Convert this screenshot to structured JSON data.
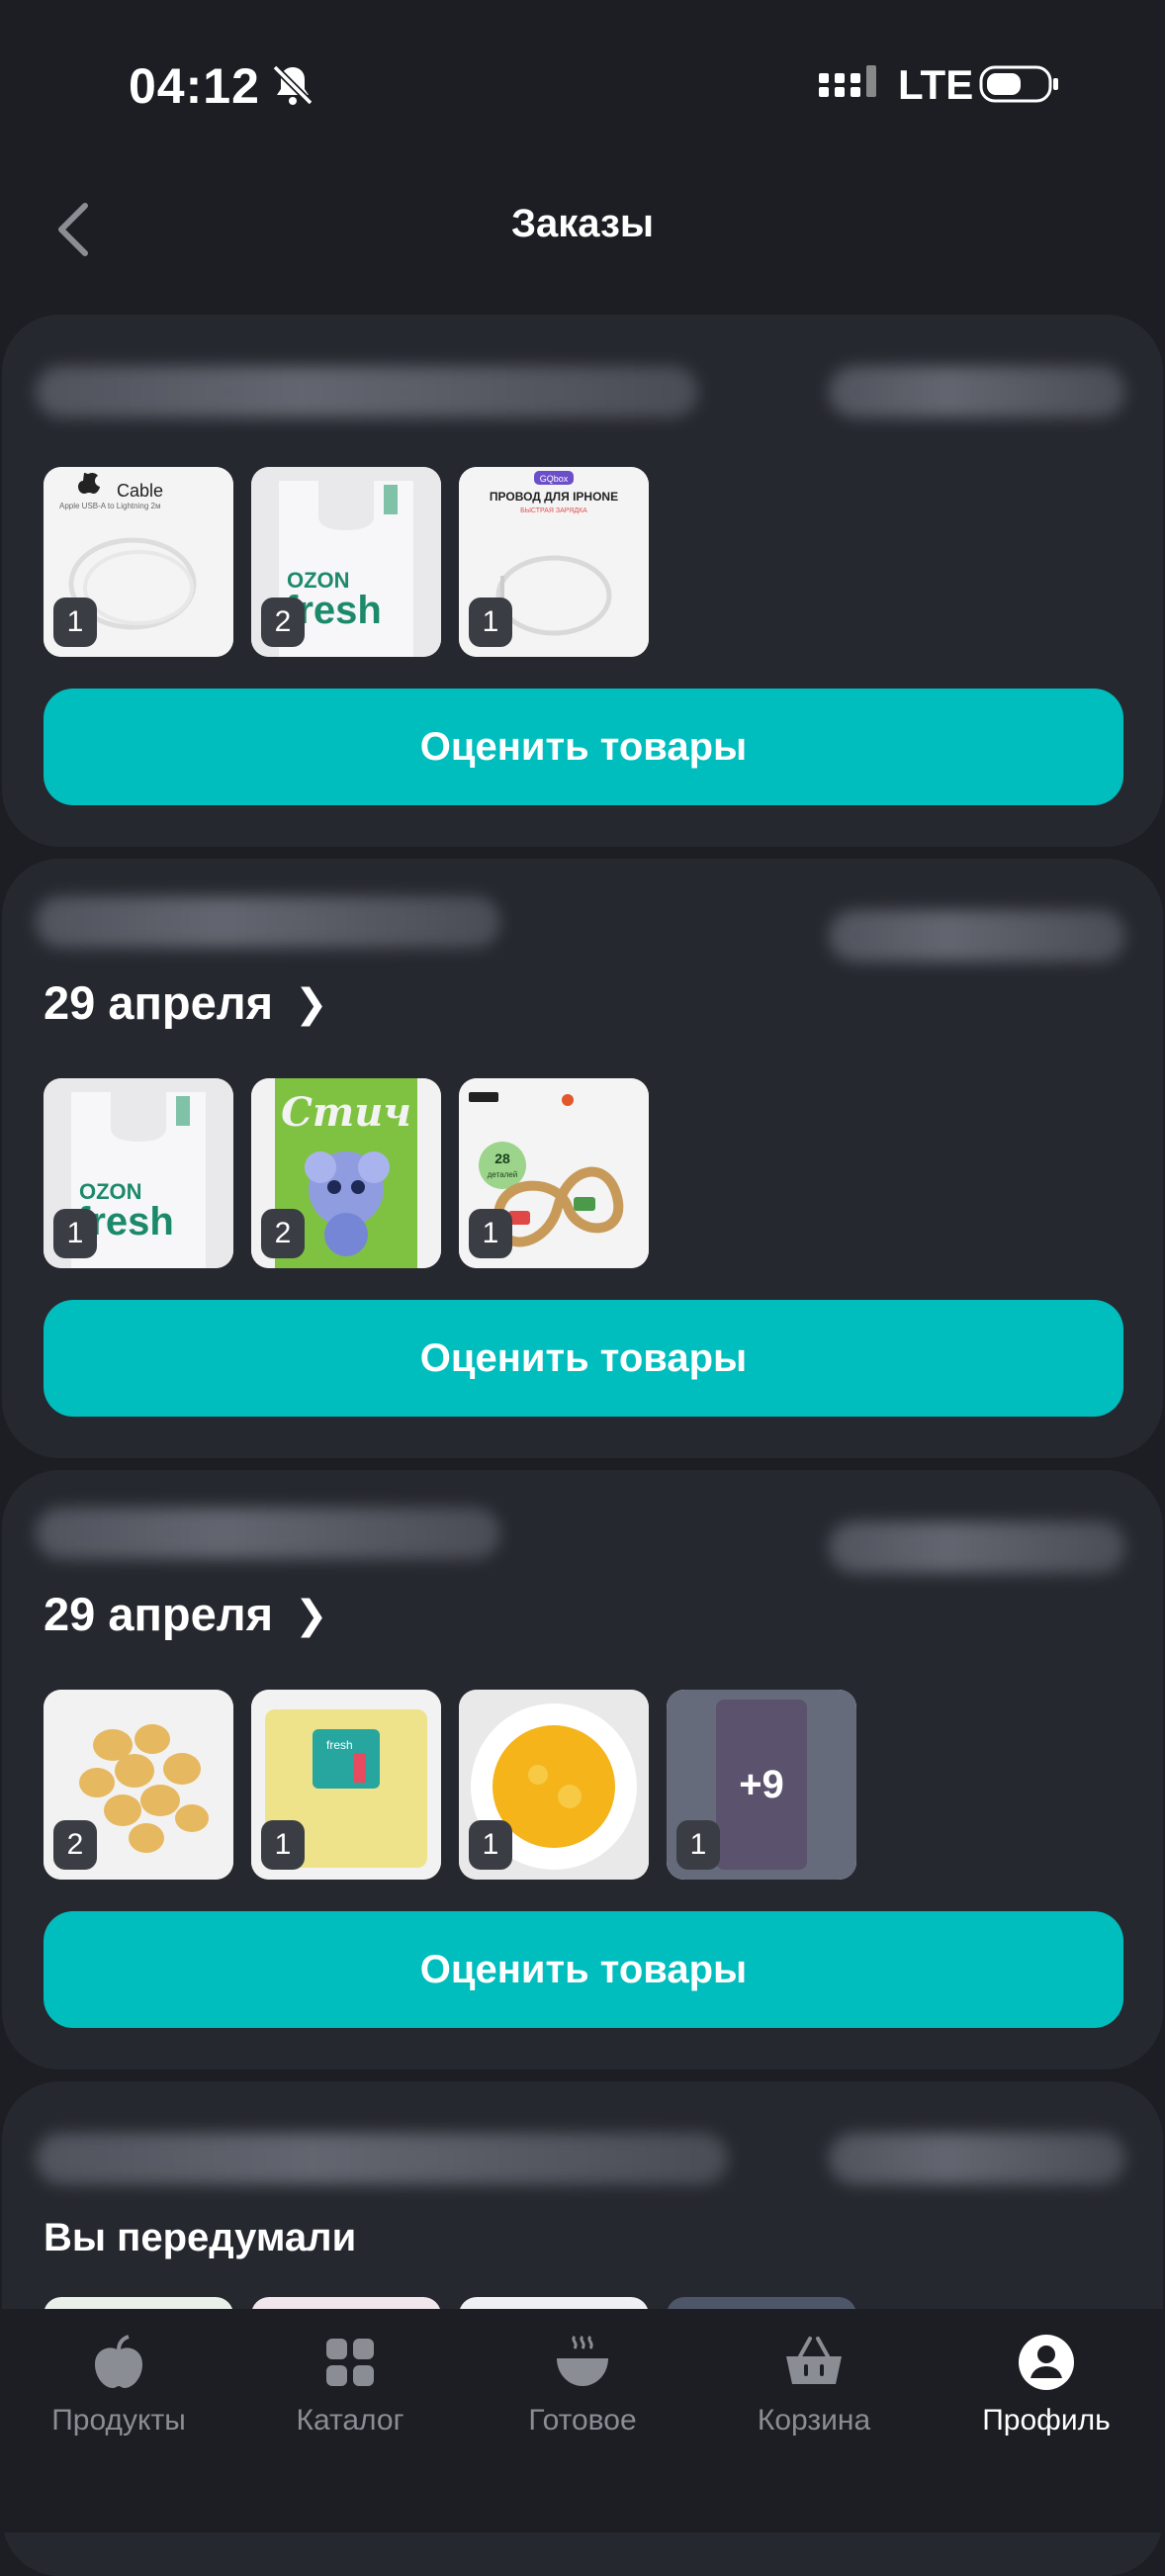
{
  "status": {
    "time": "04:12",
    "network": "LTE"
  },
  "header": {
    "title": "Заказы"
  },
  "orders": [
    {
      "date": "",
      "items": [
        {
          "name": "Cable Apple USB-A to Lightning",
          "label": "Cable",
          "sublabel": "Apple USB-A to Lightning 2м",
          "qty": "1"
        },
        {
          "name": "OZON fresh пакет",
          "label1": "OZON",
          "label2": "fresh",
          "qty": "2"
        },
        {
          "name": "Провод для iPhone",
          "brand": "GQbox",
          "label": "ПРОВОД ДЛЯ IPHONE",
          "sublabel": "БЫСТРАЯ ЗАРЯДКА",
          "qty": "1"
        }
      ],
      "rate_label": "Оценить товары"
    },
    {
      "date": "29 апреля",
      "items": [
        {
          "name": "OZON fresh пакет",
          "label1": "OZON",
          "label2": "fresh",
          "qty": "1"
        },
        {
          "name": "Стич",
          "label": "Стич",
          "qty": "2"
        },
        {
          "name": "Железная дорога",
          "badge_num": "28",
          "badge_text": "деталей",
          "qty": "1"
        }
      ],
      "rate_label": "Оценить товары"
    },
    {
      "date": "29 апреля",
      "items": [
        {
          "name": "Картофель",
          "qty": "2"
        },
        {
          "name": "Сыр Ozon fresh",
          "label": "fresh",
          "qty": "1"
        },
        {
          "name": "Омлет",
          "qty": "1"
        },
        {
          "name": "Еще товары",
          "more": "+9",
          "qty": "1"
        }
      ],
      "rate_label": "Оценить товары"
    },
    {
      "status": "Вы передумали"
    }
  ],
  "nav": [
    {
      "label": "Продукты",
      "icon": "apple-icon"
    },
    {
      "label": "Каталог",
      "icon": "grid-icon"
    },
    {
      "label": "Готовое",
      "icon": "dish-icon"
    },
    {
      "label": "Корзина",
      "icon": "basket-icon"
    },
    {
      "label": "Профиль",
      "icon": "profile-icon",
      "active": true
    }
  ],
  "colors": {
    "accent": "#00bdbe",
    "background": "#1c1e23",
    "card": "#26282f",
    "ozon_green": "#1c8a6a"
  }
}
